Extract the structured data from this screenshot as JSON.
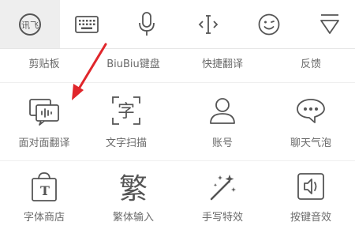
{
  "toolbar": {
    "items": [
      {
        "name": "ifly-logo-icon",
        "glyph": "讯飞",
        "active": true
      },
      {
        "name": "keyboard-icon"
      },
      {
        "name": "microphone-icon"
      },
      {
        "name": "cursor-move-icon"
      },
      {
        "name": "emoji-icon"
      },
      {
        "name": "collapse-icon"
      }
    ]
  },
  "row1": {
    "labels": [
      "剪贴板",
      "BiuBiu键盘",
      "快捷翻译",
      "反馈"
    ]
  },
  "row2": {
    "items": [
      {
        "label": "面对面翻译",
        "icon": "face-translate-icon"
      },
      {
        "label": "文字扫描",
        "icon": "text-scan-icon",
        "glyph": "字"
      },
      {
        "label": "账号",
        "icon": "account-icon"
      },
      {
        "label": "聊天气泡",
        "icon": "chat-bubble-icon"
      }
    ]
  },
  "row3": {
    "items": [
      {
        "label": "字体商店",
        "icon": "font-store-icon",
        "glyph": "T"
      },
      {
        "label": "繁体输入",
        "icon": "traditional-input-icon",
        "glyph": "繁"
      },
      {
        "label": "手写特效",
        "icon": "handwriting-effects-icon"
      },
      {
        "label": "按键音效",
        "icon": "key-sound-icon"
      }
    ]
  },
  "colors": {
    "icon": "#555555",
    "label": "#6a6a6a",
    "active_bg": "#eeeeee",
    "arrow": "#e0262b"
  }
}
